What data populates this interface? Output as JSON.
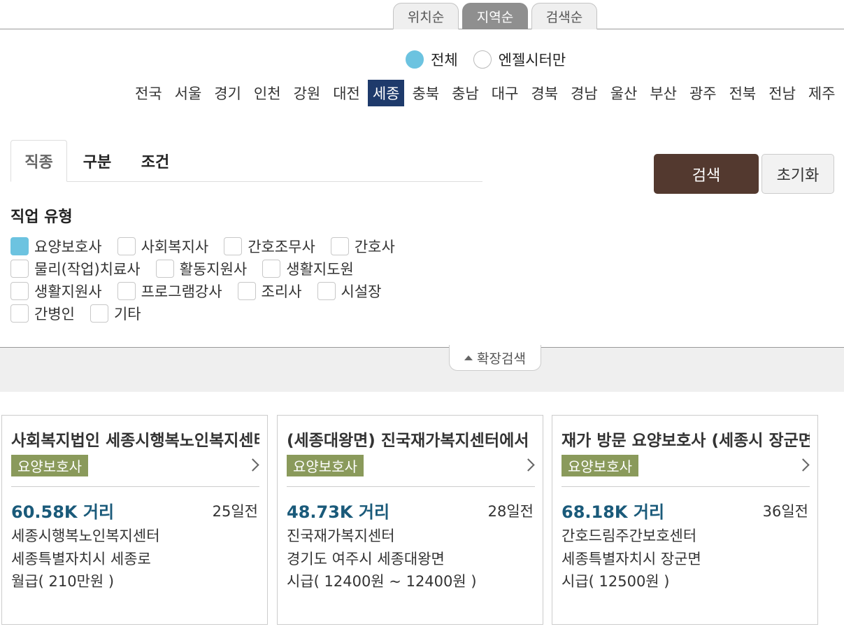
{
  "sort_tabs": [
    {
      "label": "위치순",
      "active": false
    },
    {
      "label": "지역순",
      "active": true
    },
    {
      "label": "검색순",
      "active": false
    }
  ],
  "scope": {
    "all_label": "전체",
    "angel_label": "엔젤시터만",
    "selected": "전체"
  },
  "regions": {
    "items": [
      "전국",
      "서울",
      "경기",
      "인천",
      "강원",
      "대전",
      "세종",
      "충북",
      "충남",
      "대구",
      "경북",
      "경남",
      "울산",
      "부산",
      "광주",
      "전북",
      "전남",
      "제주"
    ],
    "selected": "세종"
  },
  "filter_tabs": [
    {
      "label": "직종",
      "active": true
    },
    {
      "label": "구분",
      "active": false
    },
    {
      "label": "조건",
      "active": false
    }
  ],
  "buttons": {
    "search": "검색",
    "reset": "초기화"
  },
  "job_type": {
    "title": "직업 유형",
    "options": [
      {
        "label": "요양보호사",
        "checked": true
      },
      {
        "label": "사회복지사",
        "checked": false
      },
      {
        "label": "간호조무사",
        "checked": false
      },
      {
        "label": "간호사",
        "checked": false
      },
      {
        "label": "물리(작업)치료사",
        "checked": false
      },
      {
        "label": "활동지원사",
        "checked": false
      },
      {
        "label": "생활지도원",
        "checked": false
      },
      {
        "label": "생활지원사",
        "checked": false
      },
      {
        "label": "프로그램강사",
        "checked": false
      },
      {
        "label": "조리사",
        "checked": false
      },
      {
        "label": "시설장",
        "checked": false
      },
      {
        "label": "간병인",
        "checked": false
      },
      {
        "label": "기타",
        "checked": false
      }
    ]
  },
  "expand_label": "확장검색",
  "jobs": [
    {
      "title": "사회복지법인 세종시행복노인복지센터",
      "badge": "요양보호사",
      "distance": "60.58K 거리",
      "posted": "25일전",
      "org": "세종시행복노인복지센터",
      "address": "세종특별자치시 세종로",
      "pay": "월급( 210만원 )"
    },
    {
      "title": "(세종대왕면) 진국재가복지센터에서",
      "badge": "요양보호사",
      "distance": "48.73K 거리",
      "posted": "28일전",
      "org": "진국재가복지센터",
      "address": "경기도 여주시 세종대왕면",
      "pay": "시급( 12400원 ~ 12400원 )"
    },
    {
      "title": "재가 방문 요양보호사 (세종시 장군면)",
      "badge": "요양보호사",
      "distance": "68.18K 거리",
      "posted": "36일전",
      "org": "간호드림주간보호센터",
      "address": "세종특별자치시 장군면",
      "pay": "시급( 12500원 )"
    }
  ]
}
